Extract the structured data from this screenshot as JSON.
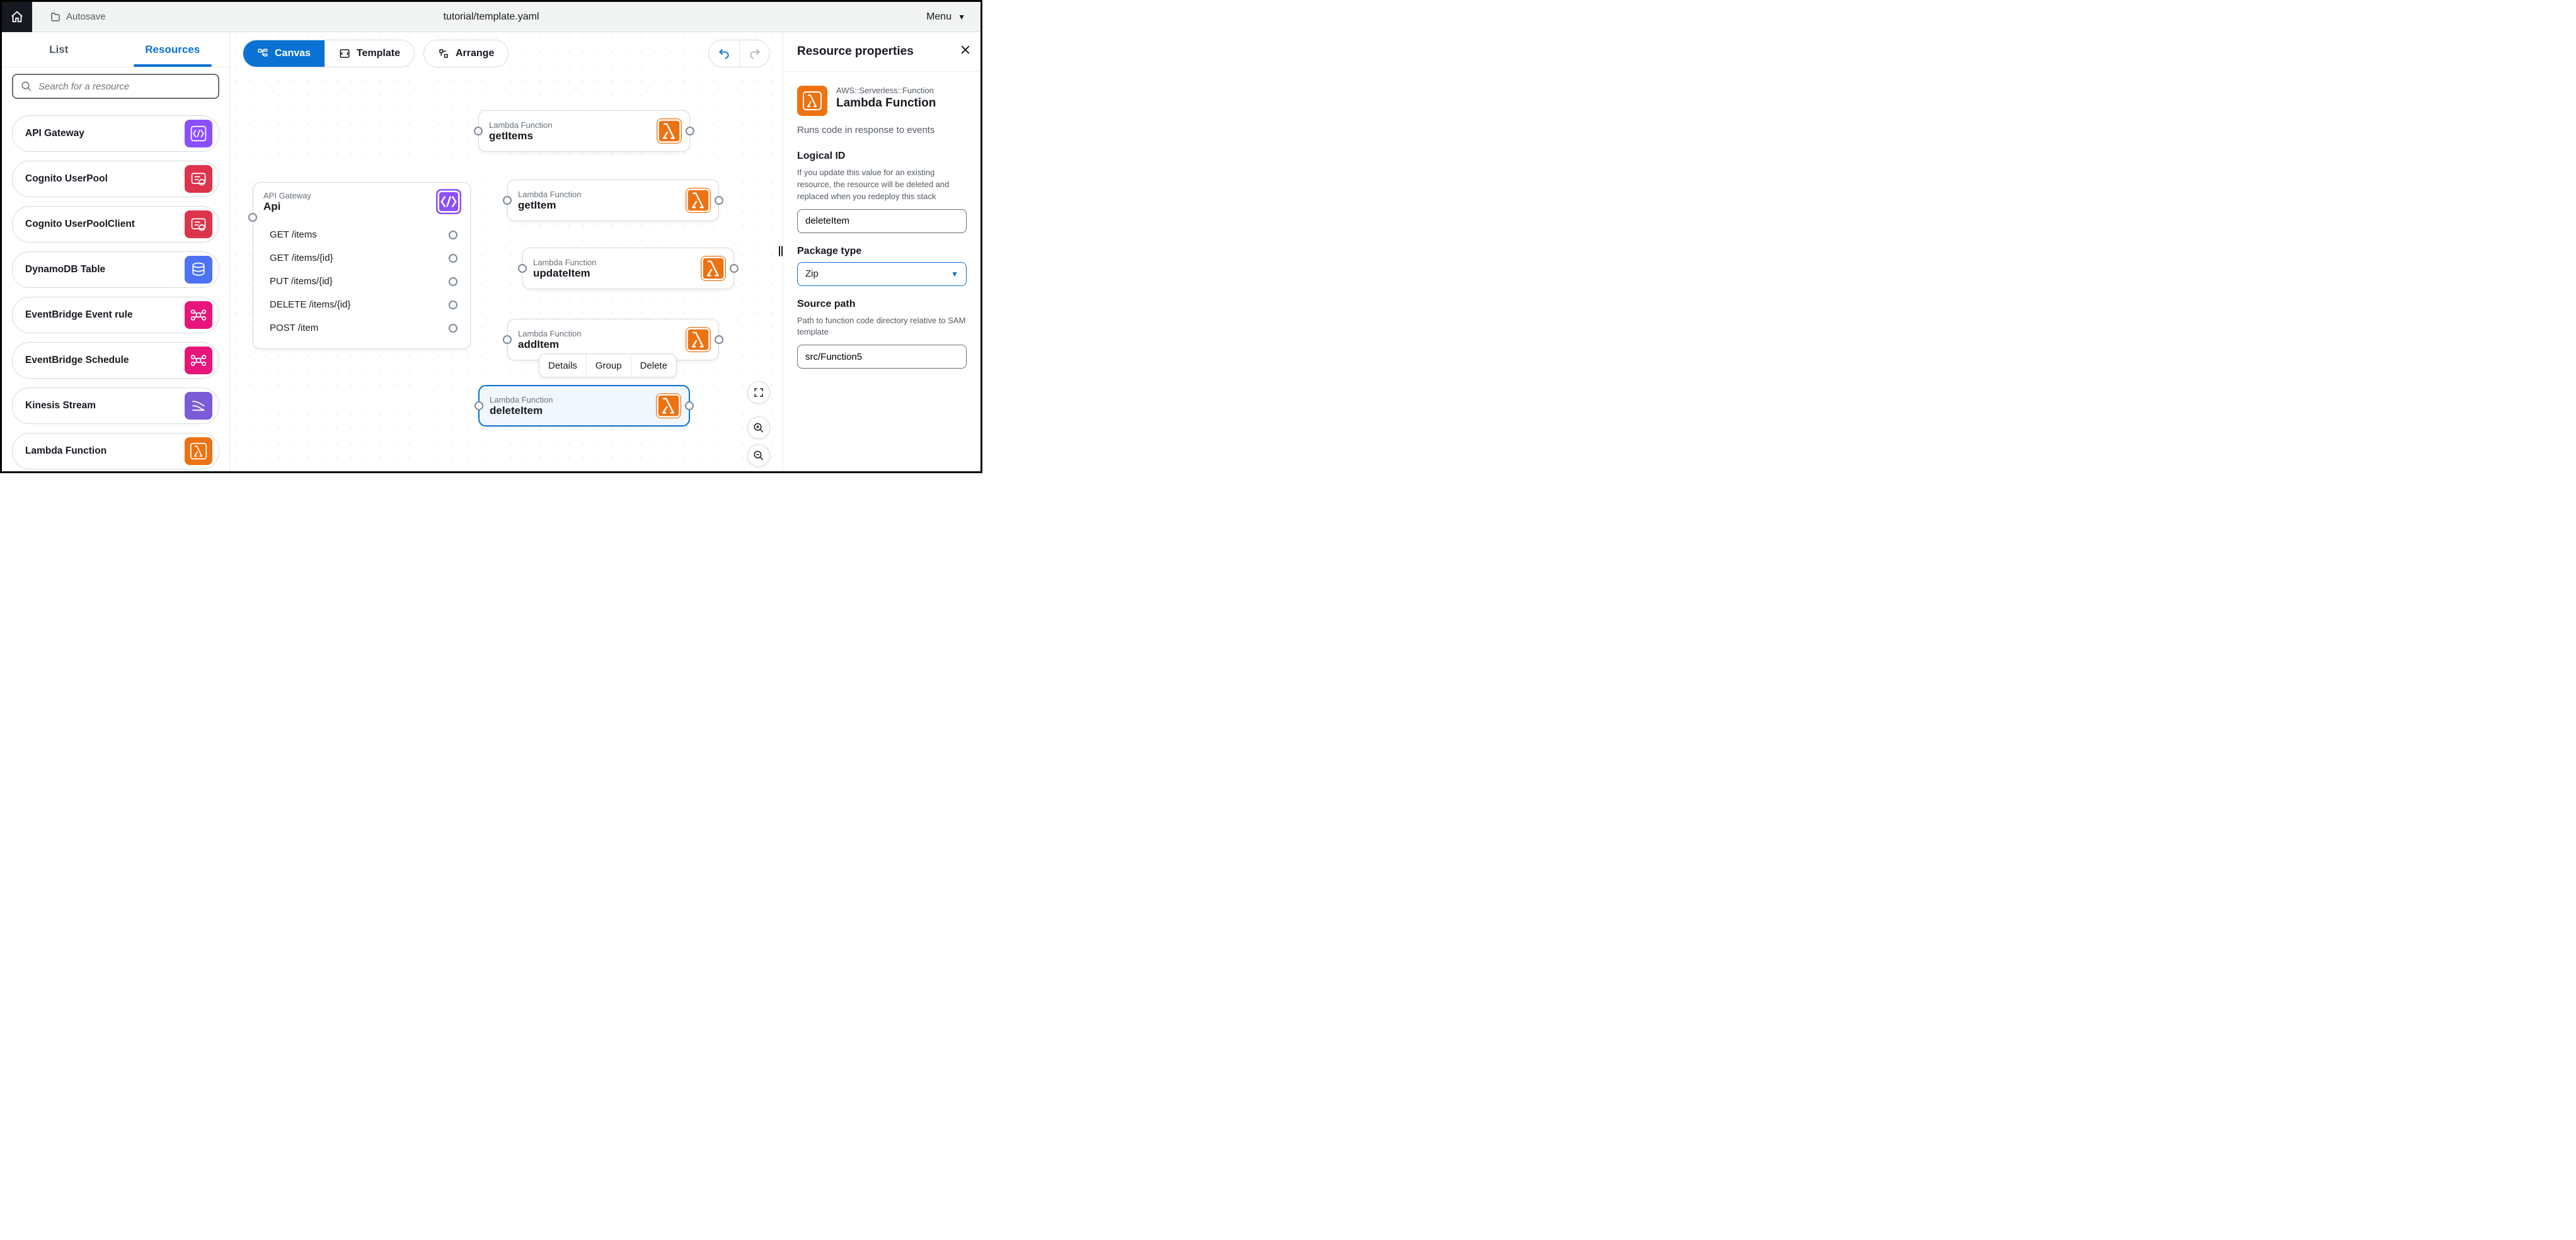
{
  "topbar": {
    "autosave_label": "Autosave",
    "title": "tutorial/template.yaml",
    "menu_label": "Menu"
  },
  "left": {
    "tab_list": "List",
    "tab_resources": "Resources",
    "search_placeholder": "Search for a resource",
    "resources": [
      {
        "label": "API Gateway",
        "icon": "api-gateway",
        "color": "bg-purple"
      },
      {
        "label": "Cognito UserPool",
        "icon": "cognito",
        "color": "bg-red"
      },
      {
        "label": "Cognito UserPoolClient",
        "icon": "cognito",
        "color": "bg-red"
      },
      {
        "label": "DynamoDB Table",
        "icon": "dynamodb",
        "color": "bg-indigo"
      },
      {
        "label": "EventBridge Event rule",
        "icon": "eventbridge",
        "color": "bg-pink"
      },
      {
        "label": "EventBridge Schedule",
        "icon": "eventbridge",
        "color": "bg-pink"
      },
      {
        "label": "Kinesis Stream",
        "icon": "kinesis",
        "color": "bg-violet"
      },
      {
        "label": "Lambda Function",
        "icon": "lambda",
        "color": "bg-orange"
      }
    ]
  },
  "toolbar": {
    "canvas": "Canvas",
    "template": "Template",
    "arrange": "Arrange"
  },
  "canvas": {
    "api": {
      "type": "API Gateway",
      "name": "Api",
      "routes": [
        "GET /items",
        "GET /items/{id}",
        "PUT /items/{id}",
        "DELETE /items/{id}",
        "POST /item"
      ]
    },
    "lambdas": [
      {
        "type": "Lambda Function",
        "name": "getItems",
        "selected": false
      },
      {
        "type": "Lambda Function",
        "name": "getItem",
        "selected": false
      },
      {
        "type": "Lambda Function",
        "name": "updateItem",
        "selected": false
      },
      {
        "type": "Lambda Function",
        "name": "addItem",
        "selected": false
      },
      {
        "type": "Lambda Function",
        "name": "deleteItem",
        "selected": true
      }
    ],
    "context": {
      "details": "Details",
      "group": "Group",
      "delete": "Delete"
    }
  },
  "right": {
    "header": "Resource properties",
    "cfn_type": "AWS::Serverless::Function",
    "title": "Lambda Function",
    "desc": "Runs code in response to events",
    "logical_id_label": "Logical ID",
    "logical_id_help": "If you update this value for an existing resource, the resource will be deleted and replaced when you redeploy this stack",
    "logical_id_value": "deleteItem",
    "package_type_label": "Package type",
    "package_type_value": "Zip",
    "source_path_label": "Source path",
    "source_path_help": "Path to function code directory relative to SAM template",
    "source_path_value": "src/Function5"
  }
}
